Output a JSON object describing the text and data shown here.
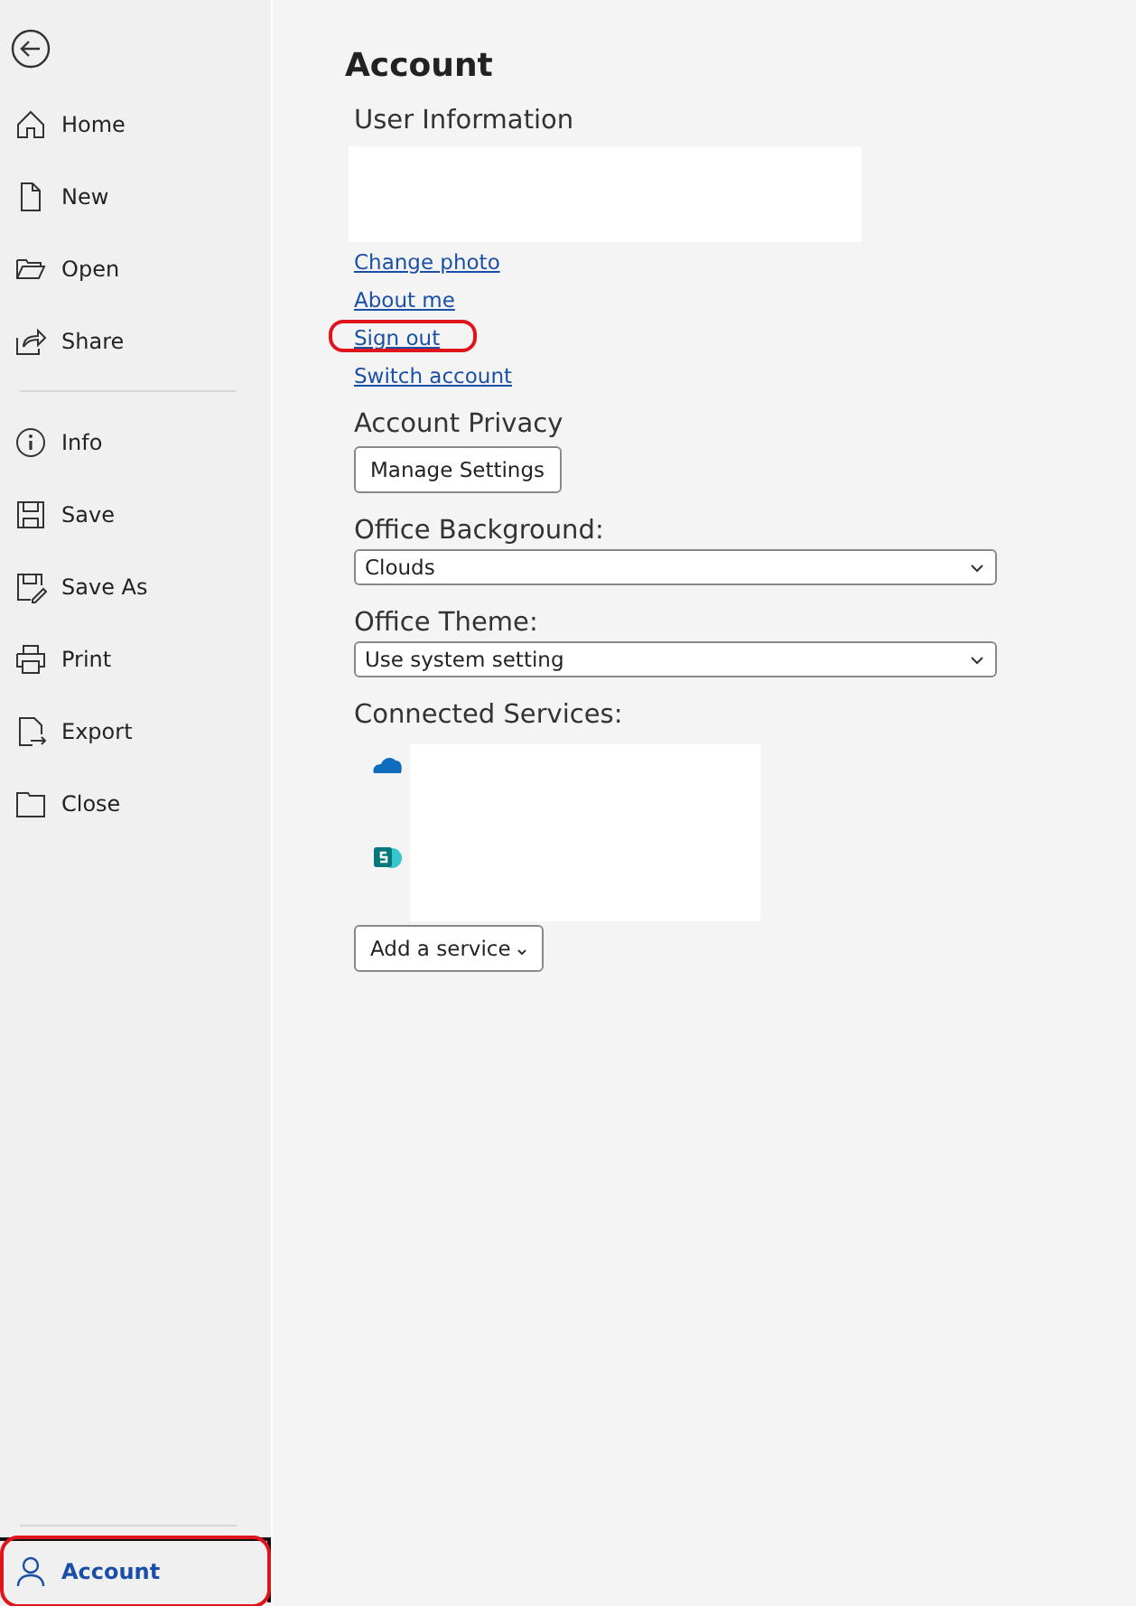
{
  "nav": {
    "top": [
      {
        "label": "Home",
        "selected": false
      },
      {
        "label": "New",
        "selected": false
      },
      {
        "label": "Open",
        "selected": false
      },
      {
        "label": "Share",
        "selected": false
      }
    ],
    "middle": [
      {
        "label": "Info",
        "selected": false
      },
      {
        "label": "Save",
        "selected": false
      },
      {
        "label": "Save As",
        "selected": false
      },
      {
        "label": "Print",
        "selected": false
      },
      {
        "label": "Export",
        "selected": false
      },
      {
        "label": "Close",
        "selected": false
      }
    ],
    "bottom": [
      {
        "label": "Account",
        "selected": true
      }
    ]
  },
  "title": "Account",
  "user_information": {
    "heading": "User Information",
    "links": [
      {
        "label": "Change photo",
        "highlighted": false
      },
      {
        "label": "About me",
        "highlighted": false
      },
      {
        "label": "Sign out",
        "highlighted": true
      },
      {
        "label": "Switch account",
        "highlighted": false
      }
    ]
  },
  "account_privacy": {
    "heading": "Account Privacy",
    "button": "Manage Settings"
  },
  "office_background": {
    "label": "Office Background:",
    "value": "Clouds"
  },
  "office_theme": {
    "label": "Office Theme:",
    "value": "Use system setting"
  },
  "connected_services": {
    "heading": "Connected Services:",
    "services": [
      {
        "kind": "cloud"
      },
      {
        "kind": "sharepoint"
      }
    ],
    "button": "Add a service"
  }
}
